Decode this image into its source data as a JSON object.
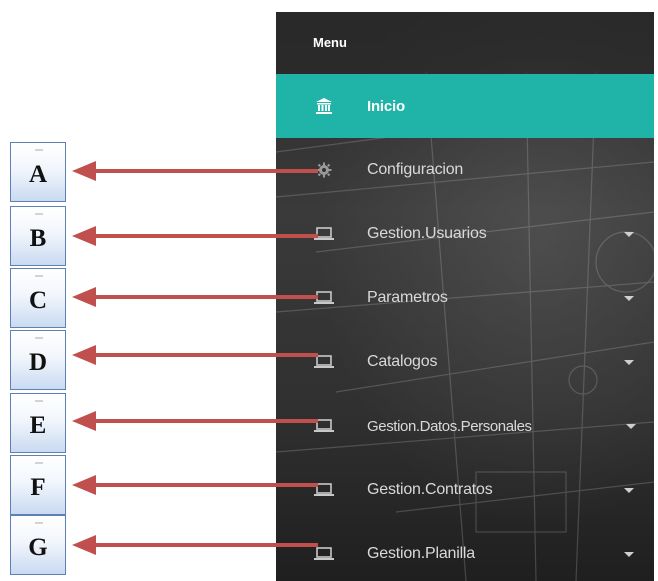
{
  "menu": {
    "header": "Menu",
    "items": [
      {
        "label": "Inicio",
        "icon": "bank-icon",
        "active": true,
        "has_submenu": false
      },
      {
        "label": "Configuracion",
        "icon": "gear-icon",
        "active": false,
        "has_submenu": false
      },
      {
        "label": "Gestion.Usuarios",
        "icon": "laptop-icon",
        "active": false,
        "has_submenu": true
      },
      {
        "label": "Parametros",
        "icon": "laptop-icon",
        "active": false,
        "has_submenu": true
      },
      {
        "label": "Catalogos",
        "icon": "laptop-icon",
        "active": false,
        "has_submenu": true
      },
      {
        "label": "Gestion.Datos.Personales",
        "icon": "laptop-icon",
        "active": false,
        "has_submenu": true
      },
      {
        "label": "Gestion.Contratos",
        "icon": "laptop-icon",
        "active": false,
        "has_submenu": true
      },
      {
        "label": "Gestion.Planilla",
        "icon": "laptop-icon",
        "active": false,
        "has_submenu": true
      }
    ]
  },
  "annotations": {
    "letters": [
      "A",
      "B",
      "C",
      "D",
      "E",
      "F",
      "G"
    ]
  },
  "colors": {
    "active_item": "#1fb4a7",
    "arrow": "#c0504d",
    "box_border": "#5f7fb7"
  }
}
